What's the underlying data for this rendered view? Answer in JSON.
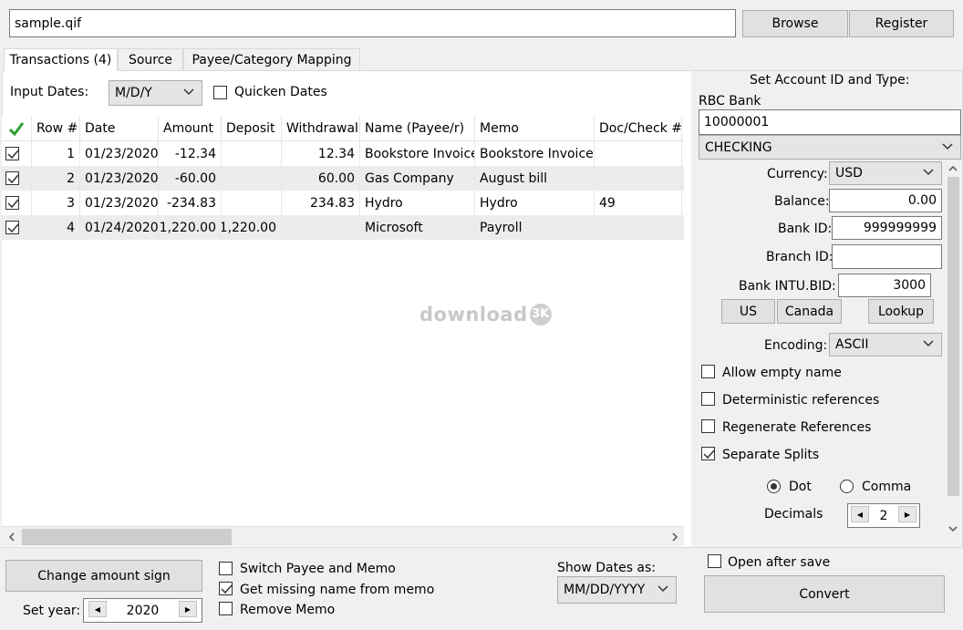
{
  "file": {
    "path": "sample.qif",
    "browse_label": "Browse",
    "register_label": "Register"
  },
  "tabs": [
    {
      "label": "Transactions (4)"
    },
    {
      "label": "Source"
    },
    {
      "label": "Payee/Category Mapping"
    }
  ],
  "input_dates": {
    "label": "Input Dates:",
    "value": "M/D/Y",
    "quicken_label": "Quicken Dates",
    "quicken_checked": false
  },
  "grid": {
    "columns": [
      "Row #",
      "Date",
      "Amount",
      "Deposit",
      "Withdrawal",
      "Name (Payee/r)",
      "Memo",
      "Doc/Check #"
    ],
    "rows": [
      {
        "row": "1",
        "date": "01/23/2020",
        "amount": "-12.34",
        "deposit": "",
        "withdrawal": "12.34",
        "name": "Bookstore Invoice",
        "memo": "Bookstore Invoice",
        "doc": ""
      },
      {
        "row": "2",
        "date": "01/23/2020",
        "amount": "-60.00",
        "deposit": "",
        "withdrawal": "60.00",
        "name": "Gas Company",
        "memo": "August bill",
        "doc": ""
      },
      {
        "row": "3",
        "date": "01/23/2020",
        "amount": "-234.83",
        "deposit": "",
        "withdrawal": "234.83",
        "name": "Hydro",
        "memo": "Hydro",
        "doc": "49"
      },
      {
        "row": "4",
        "date": "01/24/2020",
        "amount": "1,220.00",
        "deposit": "1,220.00",
        "withdrawal": "",
        "name": "Microsoft",
        "memo": "Payroll",
        "doc": ""
      }
    ],
    "watermark": "download"
  },
  "account": {
    "heading": "Set Account ID and Type:",
    "bank_name": "RBC Bank",
    "account_id": "10000001",
    "account_type": "CHECKING",
    "currency_label": "Currency:",
    "currency": "USD",
    "balance_label": "Balance:",
    "balance": "0.00",
    "bank_id_label": "Bank ID:",
    "bank_id": "999999999",
    "branch_id_label": "Branch ID:",
    "branch_id": "",
    "intu_label": "Bank INTU.BID:",
    "intu": "3000",
    "us_label": "US",
    "canada_label": "Canada",
    "lookup_label": "Lookup",
    "encoding_label": "Encoding:",
    "encoding": "ASCII",
    "allow_empty": "Allow empty name",
    "deterministic": "Deterministic references",
    "regenerate": "Regenerate References",
    "separate_splits": "Separate Splits",
    "dot_label": "Dot",
    "comma_label": "Comma",
    "decimals_label": "Decimals",
    "decimals": "2"
  },
  "bottom": {
    "change_sign_label": "Change amount sign",
    "set_year_label": "Set year:",
    "year": "2020",
    "switch_payee": "Switch Payee and Memo",
    "get_missing": "Get missing name from memo",
    "remove_memo": "Remove Memo",
    "show_dates_label": "Show Dates as:",
    "show_dates": "MM/DD/YYYY",
    "open_after_save": "Open after save",
    "convert_label": "Convert"
  }
}
